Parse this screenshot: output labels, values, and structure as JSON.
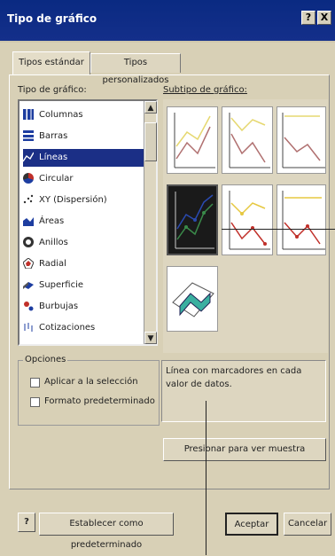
{
  "window": {
    "title": "Tipo de gráfico",
    "help_btn": "?",
    "close_btn": "X"
  },
  "tabs": [
    {
      "label": "Tipos estándar"
    },
    {
      "label": "Tipos personalizados"
    }
  ],
  "chart_type": {
    "label": "Tipo de gráfico:",
    "items": [
      {
        "label": "Columnas",
        "icon": "column-chart-icon"
      },
      {
        "label": "Barras",
        "icon": "bar-chart-icon"
      },
      {
        "label": "Líneas",
        "icon": "line-chart-icon",
        "selected": true
      },
      {
        "label": "Circular",
        "icon": "pie-chart-icon"
      },
      {
        "label": "XY (Dispersión)",
        "icon": "scatter-chart-icon"
      },
      {
        "label": "Áreas",
        "icon": "area-chart-icon"
      },
      {
        "label": "Anillos",
        "icon": "doughnut-chart-icon"
      },
      {
        "label": "Radial",
        "icon": "radar-chart-icon"
      },
      {
        "label": "Superficie",
        "icon": "surface-chart-icon"
      },
      {
        "label": "Burbujas",
        "icon": "bubble-chart-icon"
      },
      {
        "label": "Cotizaciones",
        "icon": "stock-chart-icon"
      }
    ]
  },
  "subtype": {
    "label": "Subtipo de gráfico:",
    "selected_index": 3,
    "description": "Línea con marcadores en cada valor de datos."
  },
  "options": {
    "label": "Opciones",
    "apply_selection": "Aplicar a la selección",
    "default_format": "Formato predeterminado"
  },
  "buttons": {
    "preview": "Presionar para ver muestra",
    "set_default": "Establecer como predeterminado",
    "accept": "Aceptar",
    "cancel": "Cancelar"
  }
}
